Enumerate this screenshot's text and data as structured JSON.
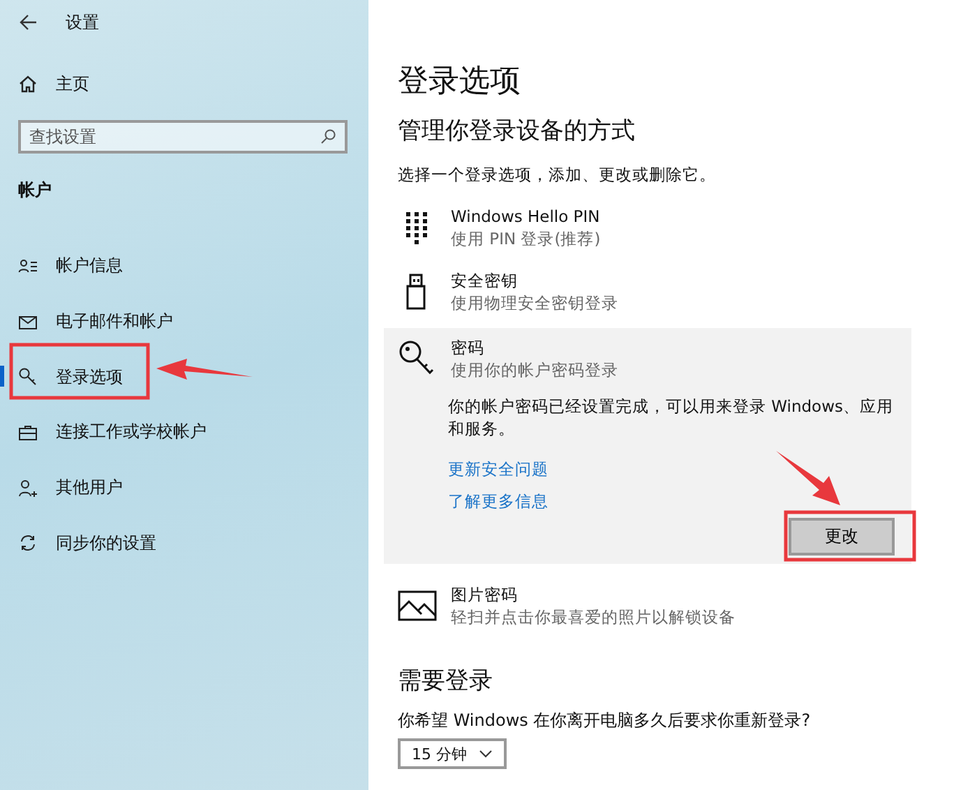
{
  "window": {
    "title": "设置"
  },
  "sidebar": {
    "home": "主页",
    "search": {
      "placeholder": "查找设置"
    },
    "section": "帐户",
    "items": [
      {
        "label": "帐户信息",
        "kind": "person-list",
        "selected": false
      },
      {
        "label": "电子邮件和帐户",
        "kind": "mail",
        "selected": false
      },
      {
        "label": "登录选项",
        "kind": "key",
        "selected": true
      },
      {
        "label": "连接工作或学校帐户",
        "kind": "briefcase",
        "selected": false
      },
      {
        "label": "其他用户",
        "kind": "person-add",
        "selected": false
      },
      {
        "label": "同步你的设置",
        "kind": "sync",
        "selected": false
      }
    ]
  },
  "main": {
    "title": "登录选项",
    "subtitle": "管理你登录设备的方式",
    "intro": "选择一个登录选项，添加、更改或删除它。",
    "options": [
      {
        "kind": "pin",
        "title": "Windows Hello PIN",
        "description": "使用 PIN 登录(推荐)",
        "expanded": false
      },
      {
        "kind": "usb-key",
        "title": "安全密钥",
        "description": "使用物理安全密钥登录",
        "expanded": false
      },
      {
        "kind": "key",
        "title": "密码",
        "description": "使用你的帐户密码登录",
        "expanded": true,
        "detail": "你的帐户密码已经设置完成，可以用来登录 Windows、应用和服务。",
        "links": [
          "更新安全问题",
          "了解更多信息"
        ],
        "button": "更改"
      },
      {
        "kind": "picture",
        "title": "图片密码",
        "description": "轻扫并点击你最喜爱的照片以解锁设备",
        "expanded": false
      }
    ],
    "section2": {
      "title": "需要登录",
      "question": "你希望 Windows 在你离开电脑多久后要求你重新登录?",
      "dropdown": "15 分钟"
    }
  }
}
